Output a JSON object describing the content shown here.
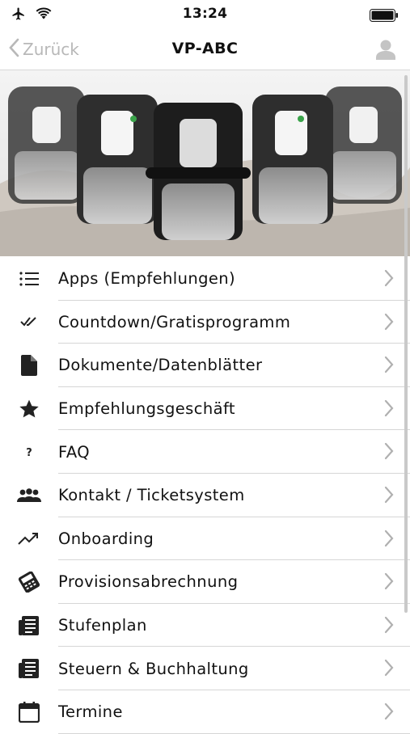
{
  "status_bar": {
    "time": "13:24",
    "icons": [
      "airplane-icon",
      "wifi-icon",
      "battery-icon"
    ]
  },
  "nav": {
    "back_label": "Zurück",
    "title": "VP-ABC",
    "profile_icon": "user-icon"
  },
  "hero": {
    "description_icon": "product-hero-image"
  },
  "menu": [
    {
      "label": "Apps (Empfehlungen)",
      "icon": "list-icon"
    },
    {
      "label": "Countdown/Gratisprogramm",
      "icon": "double-check-icon"
    },
    {
      "label": "Dokumente/Datenblätter",
      "icon": "document-icon"
    },
    {
      "label": "Empfehlungsgeschäft",
      "icon": "star-icon"
    },
    {
      "label": "FAQ",
      "icon": "question-icon"
    },
    {
      "label": "Kontakt / Ticketsystem",
      "icon": "group-icon"
    },
    {
      "label": "Onboarding",
      "icon": "trending-up-icon"
    },
    {
      "label": "Provisionsabrechnung",
      "icon": "card-terminal-icon"
    },
    {
      "label": "Stufenplan",
      "icon": "newspaper-icon"
    },
    {
      "label": "Steuern & Buchhaltung",
      "icon": "newspaper-icon"
    },
    {
      "label": "Termine",
      "icon": "calendar-icon"
    }
  ],
  "colors": {
    "text": "#111111",
    "muted": "#b8b8b8",
    "separator": "#d6d6d6"
  }
}
